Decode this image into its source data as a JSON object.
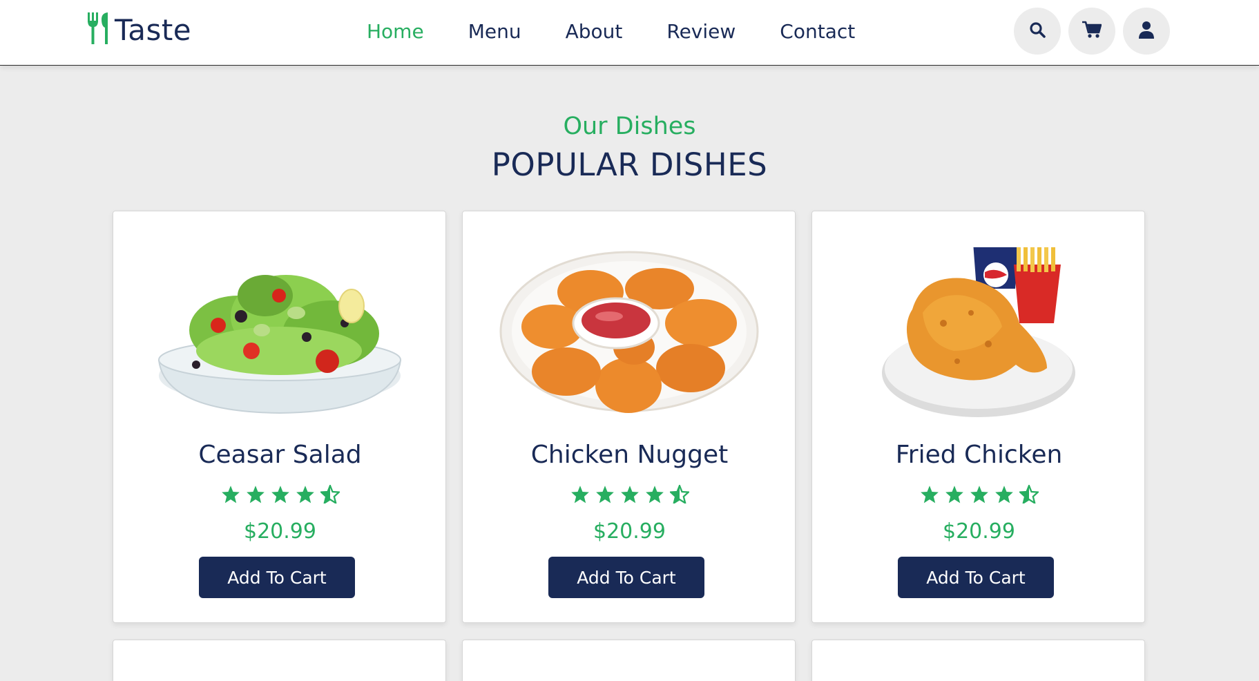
{
  "brand": {
    "name": "Taste",
    "icon": "utensils-icon",
    "accent_color": "#27ae60",
    "text_color": "#192a56"
  },
  "nav": {
    "items": [
      {
        "label": "Home",
        "active": true
      },
      {
        "label": "Menu",
        "active": false
      },
      {
        "label": "About",
        "active": false
      },
      {
        "label": "Review",
        "active": false
      },
      {
        "label": "Contact",
        "active": false
      }
    ]
  },
  "header_icons": [
    "search-icon",
    "cart-icon",
    "user-icon"
  ],
  "section": {
    "subtitle": "Our Dishes",
    "title": "POPULAR DISHES"
  },
  "dishes": [
    {
      "name": "Ceasar Salad",
      "rating": 4.5,
      "price": "$20.99",
      "button": "Add To Cart",
      "image": "salad-image"
    },
    {
      "name": "Chicken Nugget",
      "rating": 4.5,
      "price": "$20.99",
      "button": "Add To Cart",
      "image": "nuggets-image"
    },
    {
      "name": "Fried Chicken",
      "rating": 4.5,
      "price": "$20.99",
      "button": "Add To Cart",
      "image": "fried-chicken-image"
    }
  ]
}
